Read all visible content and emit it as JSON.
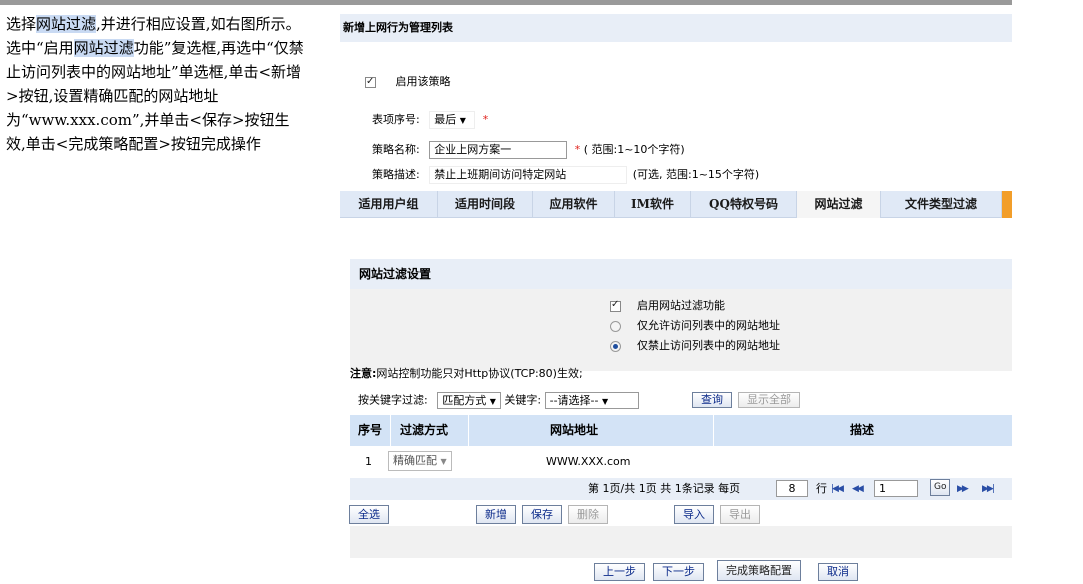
{
  "instructions": {
    "t1": "选择",
    "t1_hl": "网站过滤",
    "t2": ",并进行相应设置,如右图所示。选中“启用",
    "t2_hl": "网站过滤",
    "t3": "功能”复选框,再选中“仅禁止访问列表中的网站地址”单选框,单击<新增>按钮,设置精确匹配的网站地址为“www.xxx.com”,并单击<保存>按钮生效,单击<完成策略配置>按钮完成操作"
  },
  "panel": {
    "title": "新增上网行为管理列表",
    "enable_policy_label": "启用该策略",
    "enable_policy_checked": true,
    "index_label": "表项序号:",
    "index_value": "最后",
    "required_mark": "*",
    "name_label": "策略名称:",
    "name_value": "企业上网方案一",
    "name_hint": "( 范围:1~10个字符)",
    "desc_label": "策略描述:",
    "desc_value": "禁止上班期间访问特定网站",
    "desc_hint": "(可选, 范围:1~15个字符)"
  },
  "tabs": [
    "适用用户组",
    "适用时间段",
    "应用软件",
    "IM软件",
    "QQ特权号码",
    "网站过滤",
    "文件类型过滤"
  ],
  "active_tab": "网站过滤",
  "filter_section": {
    "title": "网站过滤设置",
    "enable_label": "启用网站过滤功能",
    "enable_checked": true,
    "allow_label": "仅允许访问列表中的网站地址",
    "allow_selected": false,
    "deny_label": "仅禁止访问列表中的网站地址",
    "deny_selected": true
  },
  "note": {
    "prefix": "注意:",
    "text": "网站控制功能只对Http协议(TCP:80)生效;"
  },
  "search": {
    "label": "按关键字过滤:",
    "match_select": "匹配方式",
    "keyword_label": "关键字:",
    "keyword_select": "--请选择--",
    "query_button": "查询",
    "show_all_button": "显示全部"
  },
  "table": {
    "headers": [
      "序号",
      "过滤方式",
      "网站地址",
      "描述"
    ],
    "rows": [
      {
        "index": "1",
        "mode": "精确匹配",
        "url": "WWW.XXX.com",
        "desc": ""
      }
    ]
  },
  "pagination": {
    "page_info": "第 1页/共 1页 共 1条记录 每页",
    "per_page": "8",
    "rows_unit": "行",
    "page_input": "1",
    "go_label": "Go"
  },
  "actions": {
    "select_all": "全选",
    "add": "新增",
    "save": "保存",
    "delete": "删除",
    "import": "导入",
    "export": "导出"
  },
  "footer": {
    "prev": "上一步",
    "next": "下一步",
    "finish": "完成策略配置",
    "cancel": "取消"
  },
  "colors": {
    "accent_orange": "#f29e2a",
    "header_blue": "#d3e3f6",
    "button_text": "#0b2a8a",
    "required_red": "#e0201b"
  }
}
